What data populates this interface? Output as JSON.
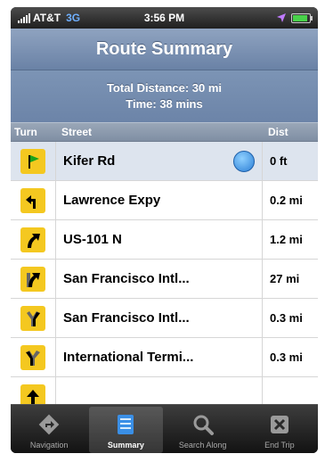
{
  "status": {
    "carrier": "AT&T",
    "network": "3G",
    "time": "3:56 PM"
  },
  "header": {
    "title": "Route Summary"
  },
  "summary": {
    "distance": "Total Distance: 30 mi",
    "time": "Time: 38 mins"
  },
  "columns": {
    "turn": "Turn",
    "street": "Street",
    "dist": "Dist"
  },
  "rows": [
    {
      "street": "Kifer Rd",
      "dist": "0 ft",
      "icon": "start-flag-icon"
    },
    {
      "street": "Lawrence Expy",
      "dist": "0.2 mi",
      "icon": "turn-left-icon"
    },
    {
      "street": "US-101 N",
      "dist": "1.2 mi",
      "icon": "bear-right-icon"
    },
    {
      "street": "San Francisco Intl...",
      "dist": "27 mi",
      "icon": "ramp-right-icon"
    },
    {
      "street": "San Francisco Intl...",
      "dist": "0.3 mi",
      "icon": "fork-right-icon"
    },
    {
      "street": "International Termi...",
      "dist": "0.3 mi",
      "icon": "fork-left-icon"
    }
  ],
  "tabs": [
    {
      "label": "Navigation",
      "icon": "navigation-icon"
    },
    {
      "label": "Summary",
      "icon": "summary-icon"
    },
    {
      "label": "Search Along",
      "icon": "search-icon"
    },
    {
      "label": "End Trip",
      "icon": "end-trip-icon"
    }
  ],
  "colors": {
    "accent": "#6a82a6",
    "turn_sign": "#f4c820",
    "selected_row": "#dde4ee",
    "battery": "#49d24a"
  }
}
